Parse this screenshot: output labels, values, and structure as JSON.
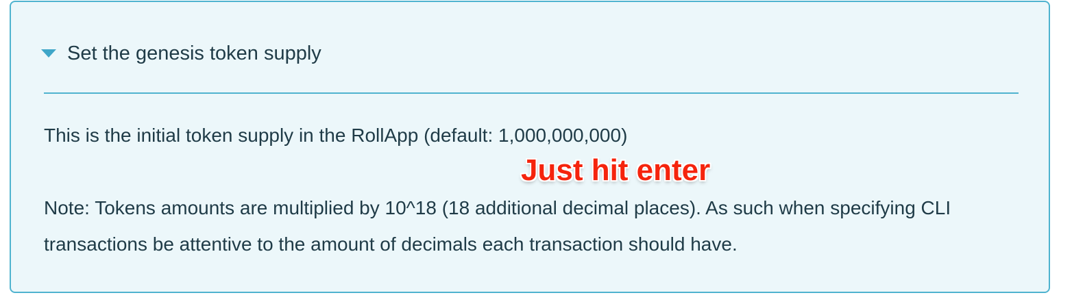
{
  "details": {
    "summary_label": "Set the genesis token supply",
    "expanded": true,
    "paragraph_1": "This is the initial token supply in the RollApp (default: 1,000,000,000)",
    "paragraph_2": "Note: Tokens amounts are multiplied by 10^18 (18 additional decimal places). As such when specifying CLI transactions be attentive to the amount of decimals each transaction should have."
  },
  "annotation": {
    "text": "Just hit enter",
    "color": "#f5240d"
  },
  "theme": {
    "box_background": "#ecf7fa",
    "box_border": "#4fb3cf",
    "text_color": "#1f3b47"
  }
}
